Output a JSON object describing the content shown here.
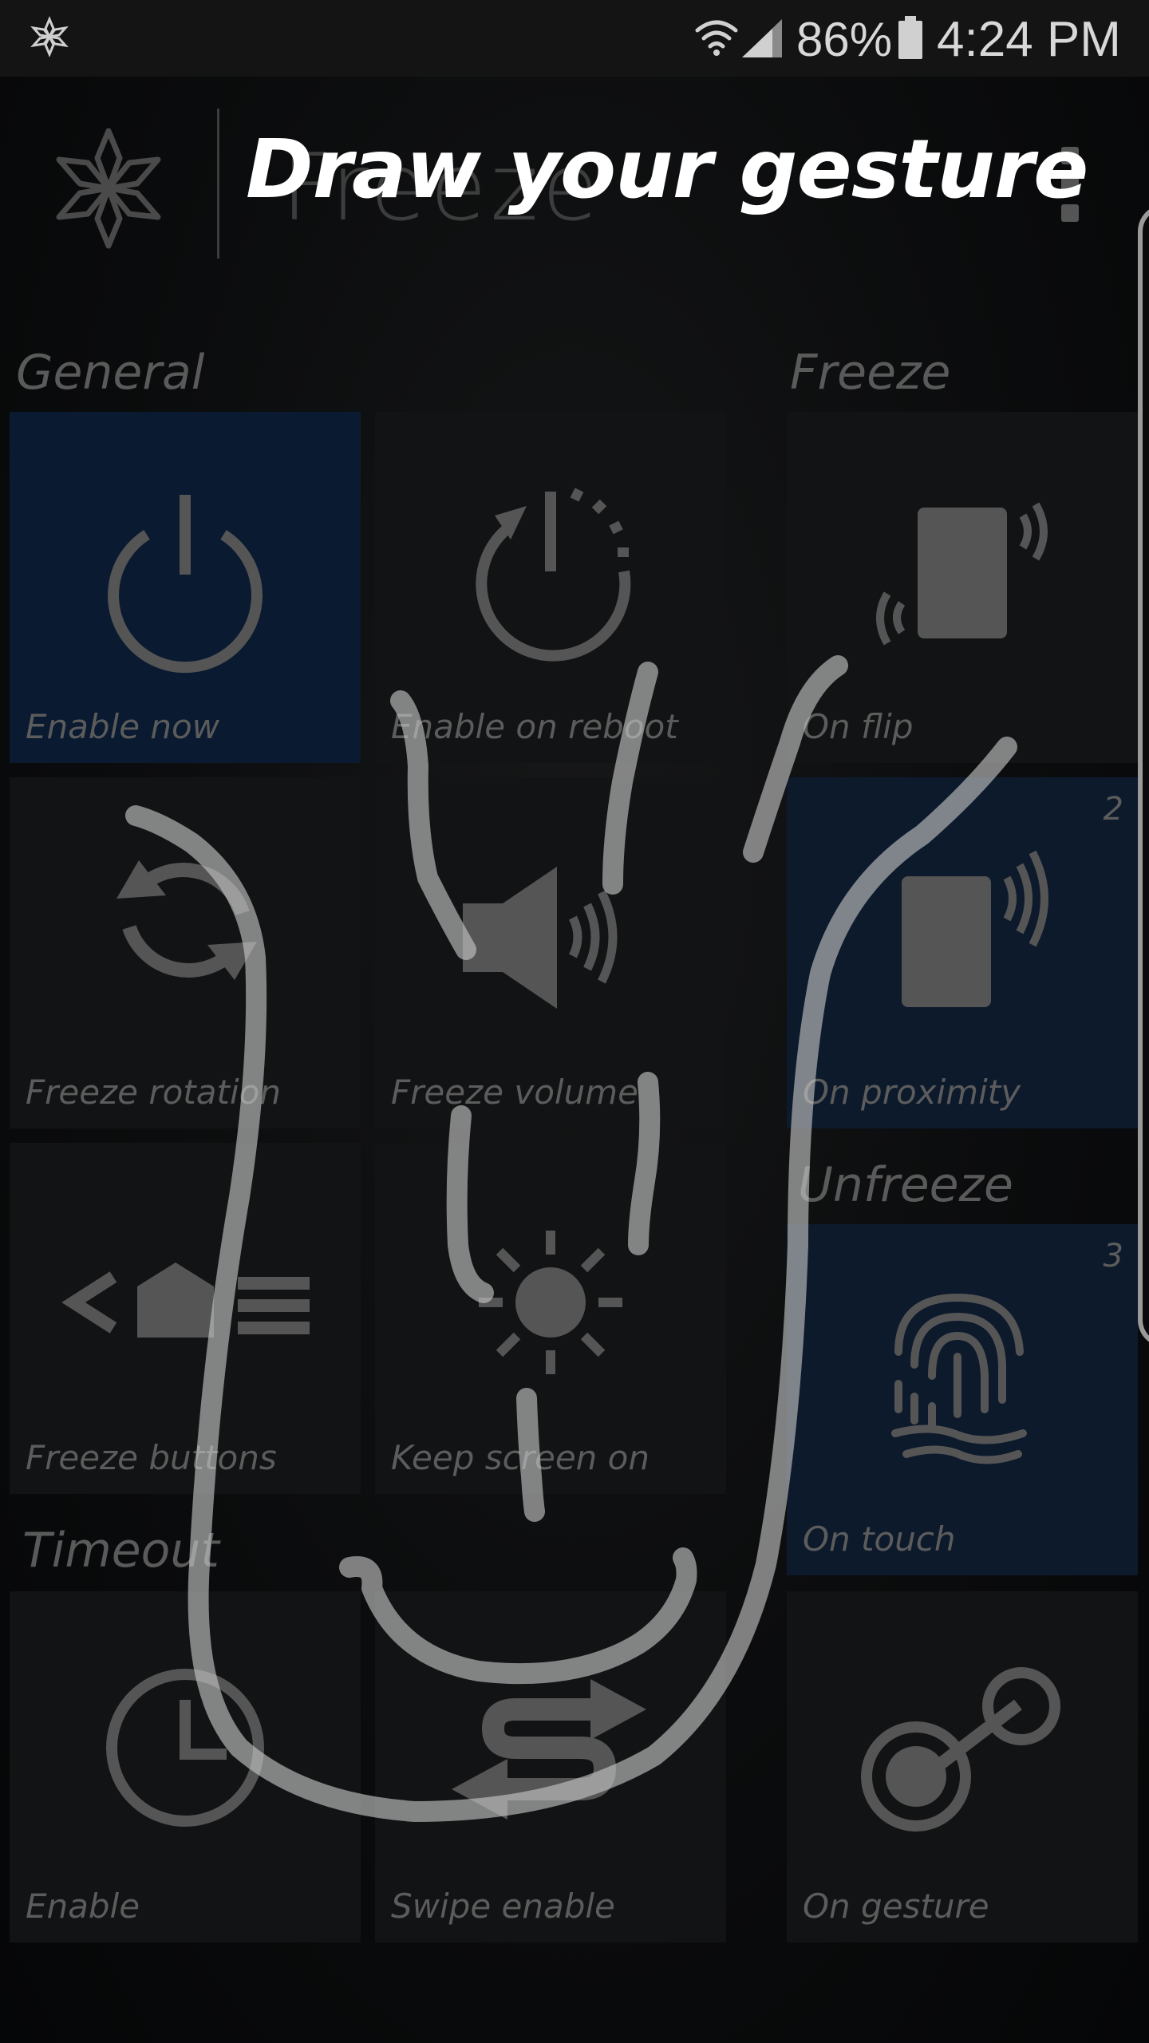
{
  "status_bar": {
    "battery_percent": "86%",
    "time": "4:24 PM",
    "icons": [
      "freeze-status-icon",
      "wifi-icon",
      "signal-icon",
      "battery-icon"
    ]
  },
  "app_bar": {
    "title": "Freeze",
    "menu_icon": "overflow-menu-icon"
  },
  "gesture_prompt": "Draw your gesture",
  "sections": {
    "general": "General",
    "freeze": "Freeze",
    "unfreeze": "Unfreeze",
    "timeout": "Timeout"
  },
  "tiles": {
    "enable_now": {
      "label": "Enable now",
      "icon": "power-icon",
      "active": true
    },
    "enable_on_reboot": {
      "label": "Enable on reboot",
      "icon": "reboot-power-icon",
      "active": false
    },
    "on_flip": {
      "label": "On flip",
      "icon": "phone-flip-icon",
      "active": false
    },
    "freeze_rotation": {
      "label": "Freeze rotation",
      "icon": "rotation-icon",
      "active": false
    },
    "freeze_volume": {
      "label": "Freeze volume",
      "icon": "volume-icon",
      "active": false
    },
    "on_proximity": {
      "label": "On proximity",
      "icon": "proximity-icon",
      "active": true,
      "badge": "2"
    },
    "freeze_buttons": {
      "label": "Freeze buttons",
      "icon": "nav-buttons-icon",
      "active": false
    },
    "keep_screen_on": {
      "label": "Keep screen on",
      "icon": "brightness-icon",
      "active": false
    },
    "on_touch": {
      "label": "On touch",
      "icon": "fingerprint-icon",
      "active": true,
      "badge": "3"
    },
    "timeout_enable": {
      "label": "Enable",
      "icon": "clock-icon",
      "active": false
    },
    "swipe_enable": {
      "label": "Swipe enable",
      "icon": "swipe-icon",
      "active": false
    },
    "on_gesture": {
      "label": "On gesture",
      "icon": "gesture-icon",
      "active": false
    }
  },
  "colors": {
    "active_tile": "#0a1a30",
    "inactive_tile": "#121314",
    "icon_gray": "#555555",
    "gesture_stroke": "#c8c8c8",
    "prompt_text": "#ffffff"
  }
}
